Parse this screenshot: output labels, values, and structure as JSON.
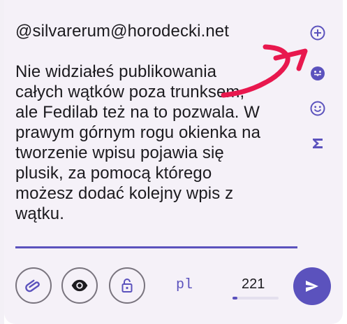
{
  "compose": {
    "text": "@silvarerum@horodecki.net\n\nNie widziałeś publikowania\ncałych wątków poza trunksem,\nale Fedilab też na to pozwala. W\nprawym górnym rogu okienka na\ntworzenie wpisu pojawia się\nplusik, za pomocą którego\nmożesz dodać kolejny wpis z\nwątku."
  },
  "side_icons": [
    "plus-circle-icon",
    "emoji-stick-out-tongue-icon",
    "emoji-smile-icon",
    "sigma-icon"
  ],
  "toolbar": {
    "buttons": [
      "attachment-icon",
      "visibility-eye-icon",
      "lock-icon"
    ],
    "language": "pl",
    "char_count": "221",
    "char_progress_fraction": 0.11
  },
  "colors": {
    "accent": "#5b52bd",
    "background": "#f5f1f8",
    "text": "#1c1b1f",
    "annotation_arrow": "#e8184e"
  }
}
